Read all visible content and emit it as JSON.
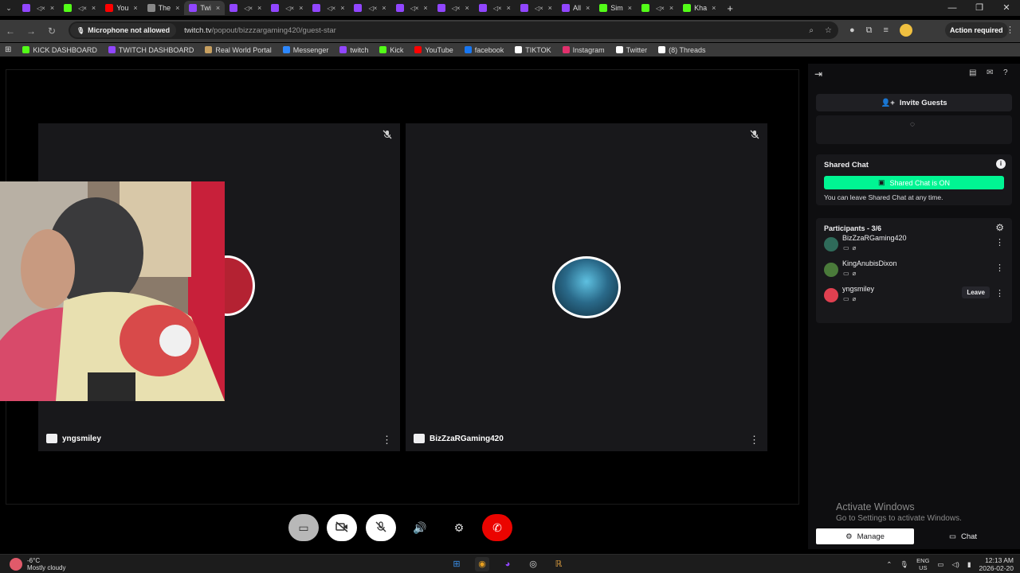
{
  "browser": {
    "tabs": [
      {
        "label": "",
        "color": "#9146ff"
      },
      {
        "label": "",
        "color": "#53fc18"
      },
      {
        "label": "You",
        "color": "#ff0000"
      },
      {
        "label": "The",
        "color": "#888888"
      },
      {
        "label": "Twi",
        "color": "#9146ff",
        "active": true
      },
      {
        "label": "",
        "color": "#9146ff"
      },
      {
        "label": "",
        "color": "#9146ff"
      },
      {
        "label": "",
        "color": "#9146ff"
      },
      {
        "label": "",
        "color": "#9146ff"
      },
      {
        "label": "",
        "color": "#9146ff"
      },
      {
        "label": "",
        "color": "#9146ff"
      },
      {
        "label": "",
        "color": "#9146ff"
      },
      {
        "label": "",
        "color": "#9146ff"
      },
      {
        "label": "All",
        "color": "#9146ff"
      },
      {
        "label": "Sim",
        "color": "#53fc18"
      },
      {
        "label": "",
        "color": "#53fc18"
      },
      {
        "label": "Kha",
        "color": "#53fc18"
      }
    ],
    "mic_chip": "Microphone not allowed",
    "url_main": "twitch.tv",
    "url_path": "/popout/bizzzargaming420/guest-star",
    "action_required": "Action required",
    "bookmarks": [
      {
        "label": "KICK DASHBOARD",
        "color": "#53fc18"
      },
      {
        "label": "TWITCH DASHBOARD",
        "color": "#9146ff"
      },
      {
        "label": "Real World Portal",
        "color": "#c8a060"
      },
      {
        "label": "Messenger",
        "color": "#2d88ff"
      },
      {
        "label": "twitch",
        "color": "#9146ff"
      },
      {
        "label": "Kick",
        "color": "#53fc18"
      },
      {
        "label": "YouTube",
        "color": "#ff0000"
      },
      {
        "label": "facebook",
        "color": "#1877f2"
      },
      {
        "label": "TIKTOK",
        "color": "#ffffff"
      },
      {
        "label": "Instagram",
        "color": "#e1306c"
      },
      {
        "label": "Twitter",
        "color": "#ffffff"
      },
      {
        "label": "(8) Threads",
        "color": "#ffffff"
      }
    ]
  },
  "guest_star": {
    "tile_left_name": "yngsmiley",
    "tile_right_name": "BizZzaRGaming420"
  },
  "panel": {
    "invite": "Invite Guests",
    "shared_chat_title": "Shared Chat",
    "shared_chat_status": "Shared Chat is ON",
    "shared_chat_sub": "You can leave Shared Chat at any time.",
    "participants_title": "Participants - 3/6",
    "participants": [
      {
        "name": "BizZzaRGaming420",
        "color": "#2f6b5a"
      },
      {
        "name": "KingAnubisDixon",
        "color": "#4a7a3a"
      },
      {
        "name": "yngsmiley",
        "color": "#e04050",
        "leave": "Leave"
      }
    ],
    "manage": "Manage",
    "chat": "Chat"
  },
  "windows": {
    "activate_title": "Activate Windows",
    "activate_sub": "Go to Settings to activate Windows.",
    "weather_temp": "-6°C",
    "weather_desc": "Mostly cloudy",
    "lang_top": "ENG",
    "lang_bottom": "US",
    "time": "12:13 AM",
    "date": "2026-02-20"
  }
}
